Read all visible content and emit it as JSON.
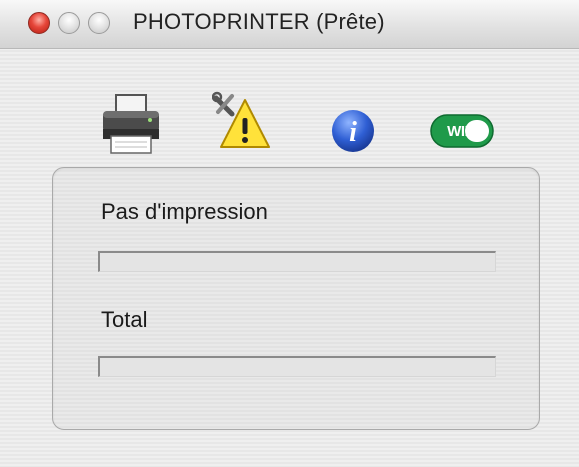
{
  "window": {
    "title": "PHOTOPRINTER (Prête)"
  },
  "toolbar": {
    "icons": [
      {
        "name": "printer-icon"
      },
      {
        "name": "maintenance-warning-icon"
      },
      {
        "name": "info-icon",
        "glyph": "i"
      },
      {
        "name": "wifi-icon",
        "glyph": "WIFI"
      }
    ]
  },
  "status": {
    "pages_label": "Pas d'impression",
    "pages_progress": 0,
    "total_label": "Total",
    "total_progress": 0
  },
  "colors": {
    "close_button": "#e6463a",
    "info_blue": "#2f5fd4",
    "wifi_green": "#1f9a4a",
    "warning_yellow": "#ffe23a"
  }
}
